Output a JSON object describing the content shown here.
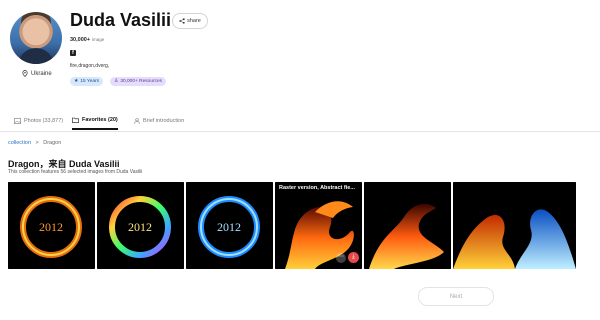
{
  "profile": {
    "name": "Duda Vasilii",
    "share_label": "share",
    "image_count": "30,000+",
    "image_unit": "image",
    "location": "Ukraine",
    "social_icon": "facebook-icon",
    "tags": "fire,dragon,dverg,",
    "badges": [
      {
        "label": "15 Years",
        "icon": "star-icon"
      },
      {
        "label": "30,000+ Resources",
        "icon": "user-icon"
      }
    ]
  },
  "tabs": [
    {
      "label": "Photos (33,877)",
      "icon": "image-icon"
    },
    {
      "label": "Favorites (20)",
      "icon": "folder-icon",
      "active": true
    },
    {
      "label": "Brief introduction",
      "icon": "person-icon"
    }
  ],
  "breadcrumb": {
    "link": "collection",
    "separator": ">",
    "current": "Dragon"
  },
  "collection": {
    "title": "Dragon，来自 Duda Vasilii",
    "description": "This collection features 56 selected images from Duda Vasilii"
  },
  "images": [
    {
      "caption": "",
      "theme": "fire-ring-2012"
    },
    {
      "caption": "",
      "theme": "rainbow-ring-2012"
    },
    {
      "caption": "",
      "theme": "blue-ring-2012"
    },
    {
      "caption": "Raster version, Abstract fie...",
      "theme": "fire-dragon",
      "hover": true
    },
    {
      "caption": "",
      "theme": "fire-dragon-2"
    },
    {
      "caption": "",
      "theme": "fire-ice-dragons"
    }
  ],
  "pagination": {
    "next_label": "Next"
  },
  "colors": {
    "accent_link": "#2a74c7",
    "download": "#e84a4a"
  }
}
